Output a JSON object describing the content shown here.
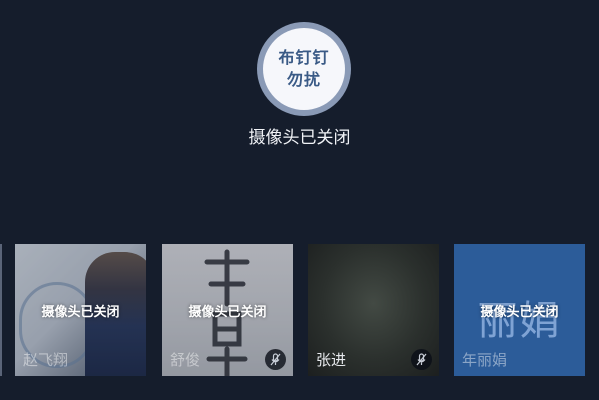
{
  "host": {
    "avatar_text": [
      "布钉钉",
      "勿扰"
    ],
    "status": "摄像头已关闭"
  },
  "participants": [
    {
      "name": "赵飞翔",
      "status": "摄像头已关闭",
      "mic_muted": false
    },
    {
      "name": "舒俊",
      "status": "摄像头已关闭",
      "mic_muted": true
    },
    {
      "name": "张进",
      "status": "",
      "mic_muted": true
    },
    {
      "name": "年丽娟",
      "status": "摄像头已关闭",
      "mic_muted": false,
      "avatar_initials": "丽娟"
    }
  ],
  "icons": {
    "mic_off": "mic-off-icon"
  },
  "colors": {
    "background": "#151d2c",
    "avatar_ring": "#8a9ab6",
    "tile_blue": "#2c5c99"
  }
}
